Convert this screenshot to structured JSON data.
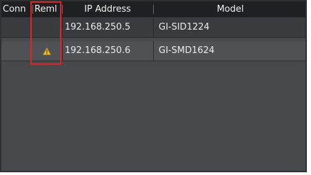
{
  "table": {
    "columns": {
      "conn": "Conn",
      "remote": "Reml",
      "ip": "IP Address",
      "model": "Model"
    },
    "rows": [
      {
        "ip": "192.168.250.5",
        "model": "GI-SID1224",
        "status_icon": "none"
      },
      {
        "ip": "192.168.250.6",
        "model": "GI-SMD1624",
        "status_icon": "warning-icon"
      }
    ]
  },
  "colors": {
    "header_bg": "#1f2022",
    "panel_bg": "#48494d",
    "row_bg_a": "#3a3b3f",
    "row_bg_b": "#505155",
    "highlight": "#e02424",
    "warning": "#f0c020"
  }
}
